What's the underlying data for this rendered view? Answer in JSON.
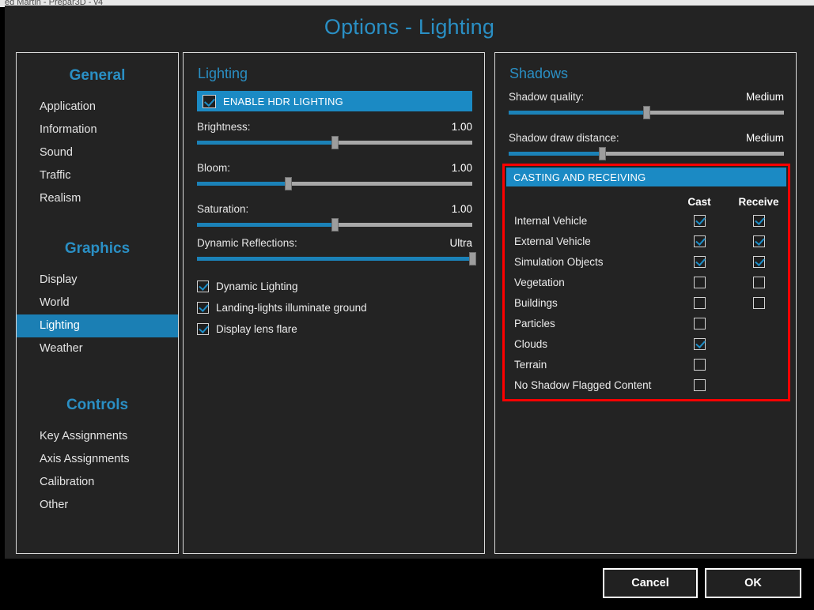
{
  "app": {
    "taskbar_title": "ed Martin - Prepar3D - v4",
    "window_title": "Options - Lighting",
    "accent_color": "#2a8fc4",
    "highlight_color": "#1b7fb4",
    "banner_color": "#1b8ac4",
    "alert_border_color": "#fe0000",
    "background_color": "#232323"
  },
  "sidebar": {
    "groups": [
      {
        "title": "General",
        "items": [
          {
            "label": "Application",
            "active": false
          },
          {
            "label": "Information",
            "active": false
          },
          {
            "label": "Sound",
            "active": false
          },
          {
            "label": "Traffic",
            "active": false
          },
          {
            "label": "Realism",
            "active": false
          }
        ]
      },
      {
        "title": "Graphics",
        "items": [
          {
            "label": "Display",
            "active": false
          },
          {
            "label": "World",
            "active": false
          },
          {
            "label": "Lighting",
            "active": true
          },
          {
            "label": "Weather",
            "active": false
          }
        ]
      },
      {
        "title": "Controls",
        "items": [
          {
            "label": "Key Assignments",
            "active": false
          },
          {
            "label": "Axis Assignments",
            "active": false
          },
          {
            "label": "Calibration",
            "active": false
          },
          {
            "label": "Other",
            "active": false
          }
        ]
      }
    ]
  },
  "lighting_panel": {
    "heading": "Lighting",
    "hdr": {
      "label": "ENABLE HDR LIGHTING",
      "checked": true
    },
    "sliders": [
      {
        "label": "Brightness:",
        "value": "1.00",
        "percent": 50
      },
      {
        "label": "Bloom:",
        "value": "1.00",
        "percent": 33
      },
      {
        "label": "Saturation:",
        "value": "1.00",
        "percent": 50
      },
      {
        "label": "Dynamic Reflections:",
        "value": "Ultra",
        "percent": 100
      }
    ],
    "checkboxes": [
      {
        "label": "Dynamic Lighting",
        "checked": true
      },
      {
        "label": "Landing-lights illuminate ground",
        "checked": true
      },
      {
        "label": "Display lens flare",
        "checked": true
      }
    ]
  },
  "shadows_panel": {
    "heading": "Shadows",
    "sliders": [
      {
        "label": "Shadow quality:",
        "value": "Medium",
        "percent": 50
      },
      {
        "label": "Shadow draw distance:",
        "value": "Medium",
        "percent": 34
      }
    ],
    "casting": {
      "banner": "CASTING AND RECEIVING",
      "columns": {
        "name": "",
        "cast": "Cast",
        "receive": "Receive"
      },
      "rows": [
        {
          "name": "Internal Vehicle",
          "cast": true,
          "has_cast": true,
          "receive": true,
          "has_receive": true
        },
        {
          "name": "External Vehicle",
          "cast": true,
          "has_cast": true,
          "receive": true,
          "has_receive": true
        },
        {
          "name": "Simulation Objects",
          "cast": true,
          "has_cast": true,
          "receive": true,
          "has_receive": true
        },
        {
          "name": "Vegetation",
          "cast": false,
          "has_cast": true,
          "receive": false,
          "has_receive": true
        },
        {
          "name": "Buildings",
          "cast": false,
          "has_cast": true,
          "receive": false,
          "has_receive": true
        },
        {
          "name": "Particles",
          "cast": false,
          "has_cast": true,
          "receive": false,
          "has_receive": false
        },
        {
          "name": "Clouds",
          "cast": true,
          "has_cast": true,
          "receive": false,
          "has_receive": false
        },
        {
          "name": "Terrain",
          "cast": false,
          "has_cast": true,
          "receive": false,
          "has_receive": false
        },
        {
          "name": "No Shadow Flagged Content",
          "cast": false,
          "has_cast": true,
          "receive": false,
          "has_receive": false
        }
      ]
    }
  },
  "footer": {
    "cancel_label": "Cancel",
    "ok_label": "OK"
  }
}
